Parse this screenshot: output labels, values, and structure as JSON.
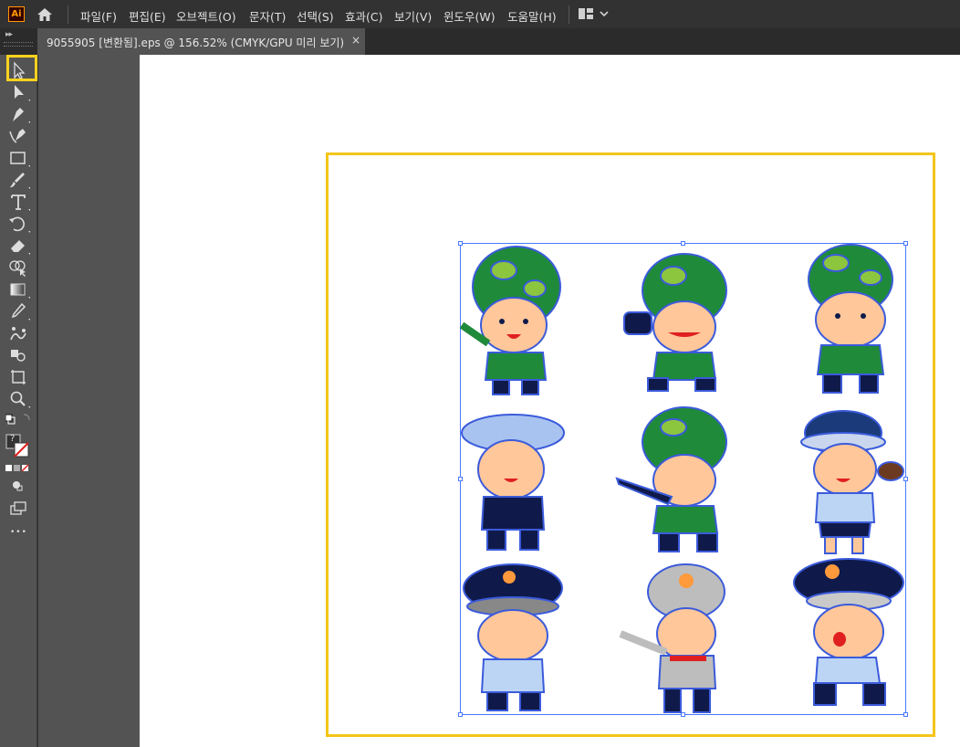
{
  "app": {
    "logo_text": "Ai",
    "menu": [
      "파일(F)",
      "편집(E)",
      "오브젝트(O)",
      "문자(T)",
      "선택(S)",
      "효과(C)",
      "보기(V)",
      "윈도우(W)",
      "도움말(H)"
    ]
  },
  "document": {
    "tab_title": "9055905 [변환됨].eps @ 156.52% (CMYK/GPU 미리 보기)",
    "close_label": "×"
  },
  "toolbar": {
    "tools": [
      "selection-tool",
      "direct-selection-tool",
      "pen-tool",
      "curvature-tool",
      "rectangle-tool",
      "paintbrush-tool",
      "type-tool",
      "rotate-tool",
      "eraser-tool",
      "shape-builder-tool",
      "gradient-tool",
      "eyedropper-tool",
      "blend-tool",
      "live-paint-tool",
      "artboard-tool",
      "zoom-tool"
    ],
    "fill_stroke_label": "?",
    "more_tools": "•••"
  },
  "colors": {
    "highlight": "#ffd21f",
    "selection": "#4a79ff",
    "camo_dark": "#1f8a3a",
    "camo_light": "#8cc63f",
    "navy": "#0f1a4a",
    "skin": "#ffc79a"
  },
  "artwork": {
    "characters": [
      "soldier-pointing",
      "soldier-binoculars",
      "soldier-standing",
      "student-cap",
      "soldier-rifle",
      "policewoman-salute",
      "police-officer-salute",
      "firefighter-pointing",
      "police-whistle-running"
    ]
  }
}
